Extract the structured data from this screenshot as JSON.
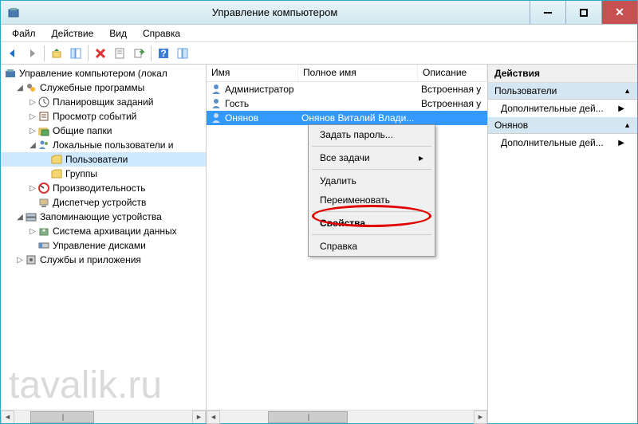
{
  "window": {
    "title": "Управление компьютером"
  },
  "menus": {
    "file": "Файл",
    "action": "Действие",
    "view": "Вид",
    "help": "Справка"
  },
  "tree": {
    "root": "Управление компьютером (локал",
    "n1": "Служебные программы",
    "n1a": "Планировщик заданий",
    "n1b": "Просмотр событий",
    "n1c": "Общие папки",
    "n1d": "Локальные пользователи и",
    "n1d1": "Пользователи",
    "n1d2": "Группы",
    "n1e": "Производительность",
    "n1f": "Диспетчер устройств",
    "n2": "Запоминающие устройства",
    "n2a": "Система архивации данных",
    "n2b": "Управление дисками",
    "n3": "Службы и приложения"
  },
  "list": {
    "col_name": "Имя",
    "col_fullname": "Полное имя",
    "col_desc": "Описание",
    "rows": [
      {
        "name": "Администратор",
        "fullname": "",
        "desc": "Встроенная у"
      },
      {
        "name": "Гость",
        "fullname": "",
        "desc": "Встроенная у"
      },
      {
        "name": "Онянов",
        "fullname": "Онянов Виталий Влади...",
        "desc": ""
      }
    ]
  },
  "actions": {
    "header": "Действия",
    "section1": "Пользователи",
    "item1": "Дополнительные дей...",
    "section2": "Онянов",
    "item2": "Дополнительные дей..."
  },
  "context": {
    "set_password": "Задать пароль...",
    "all_tasks": "Все задачи",
    "delete": "Удалить",
    "rename": "Переименовать",
    "properties": "Свойства",
    "help": "Справка"
  },
  "watermark": "tavalik.ru"
}
